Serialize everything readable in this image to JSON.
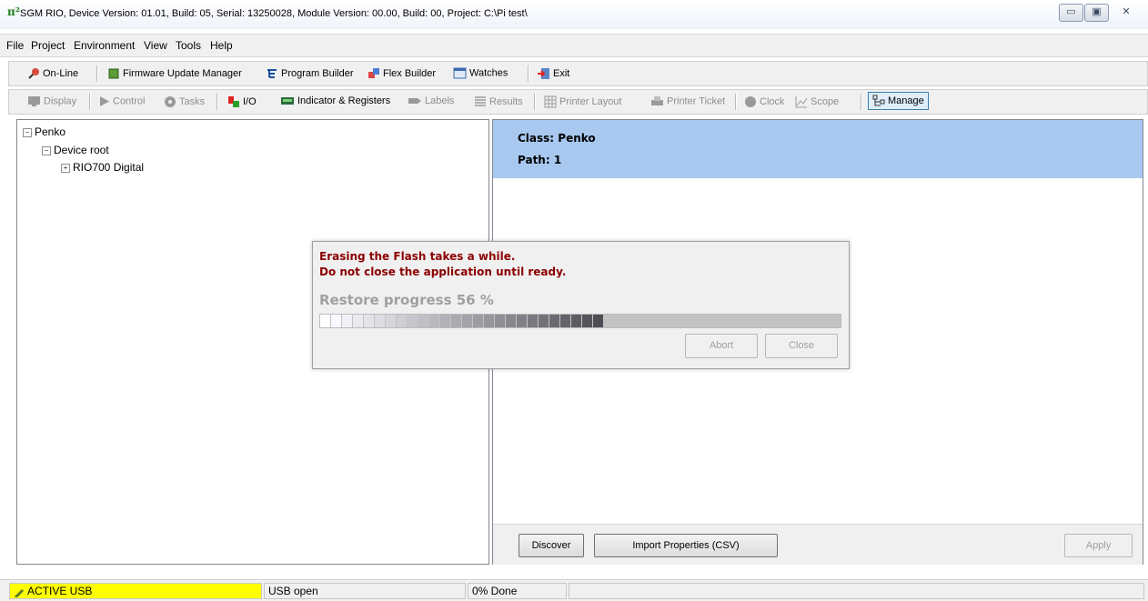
{
  "window": {
    "title": "SGM RIO, Device Version: 01.01, Build: 05, Serial: 13250028, Module Version: 00.00, Build: 00, Project: C:\\Pi test\\",
    "app_icon": "π²",
    "minimize": "▭",
    "maximize": "▣",
    "close": "✕"
  },
  "menu": [
    "File",
    "Project",
    "Environment",
    "View",
    "Tools",
    "Help"
  ],
  "toolbar1": {
    "online": "On-Line",
    "firmware": "Firmware Update Manager",
    "program_builder": "Program Builder",
    "flex_builder": "Flex Builder",
    "watches": "Watches",
    "exit": "Exit"
  },
  "toolbar2": {
    "display": "Display",
    "control": "Control",
    "tasks": "Tasks",
    "io": "I/O",
    "indicator": "Indicator & Registers",
    "labels": "Labels",
    "results": "Results",
    "printer_layout": "Printer Layout",
    "printer_ticket": "Printer Ticket",
    "clock": "Clock",
    "scope": "Scope",
    "manage": "Manage"
  },
  "tree": {
    "root": "Penko",
    "child": "Device root",
    "grandchild": "RIO700 Digital"
  },
  "details": {
    "class": "Class: Penko",
    "path": "Path: 1"
  },
  "buttons": {
    "discover": "Discover",
    "import": "Import Properties (CSV)",
    "apply": "Apply"
  },
  "dialog": {
    "line1": "Erasing the Flash takes a while.",
    "line2": "Do not close the application until ready.",
    "progress_text": "Restore progress 56 %",
    "progress_value": 0.56,
    "abort": "Abort",
    "close": "Close"
  },
  "status": {
    "connection": "ACTIVE USB",
    "usb": "USB open",
    "done": "0% Done"
  },
  "colors": {
    "info_bg": "#a8c8f0",
    "warn_text": "#8b0000",
    "status_highlight": "#ffff00"
  }
}
